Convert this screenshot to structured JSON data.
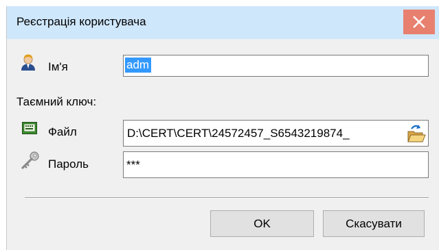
{
  "window": {
    "title": "Реєстрація користувача",
    "close_icon": "close-icon"
  },
  "form": {
    "name": {
      "label": "Ім'я",
      "value": "adm",
      "icon": "user-icon"
    },
    "secret_key_heading": "Таємний ключ:",
    "file": {
      "label": "Файл",
      "value": "D:\\CERT\\CERT\\24572457_S6543219874_",
      "icon": "keyboard-icon",
      "browse_icon": "folder-open-icon"
    },
    "password": {
      "label": "Пароль",
      "value": "***",
      "icon": "key-icon"
    }
  },
  "buttons": {
    "ok": "OK",
    "cancel": "Скасувати"
  },
  "colors": {
    "titlebar": "#cfe7fb",
    "close_button": "#e8806f",
    "dialog_background": "#f0f0f0",
    "selection": "#3399ff"
  }
}
